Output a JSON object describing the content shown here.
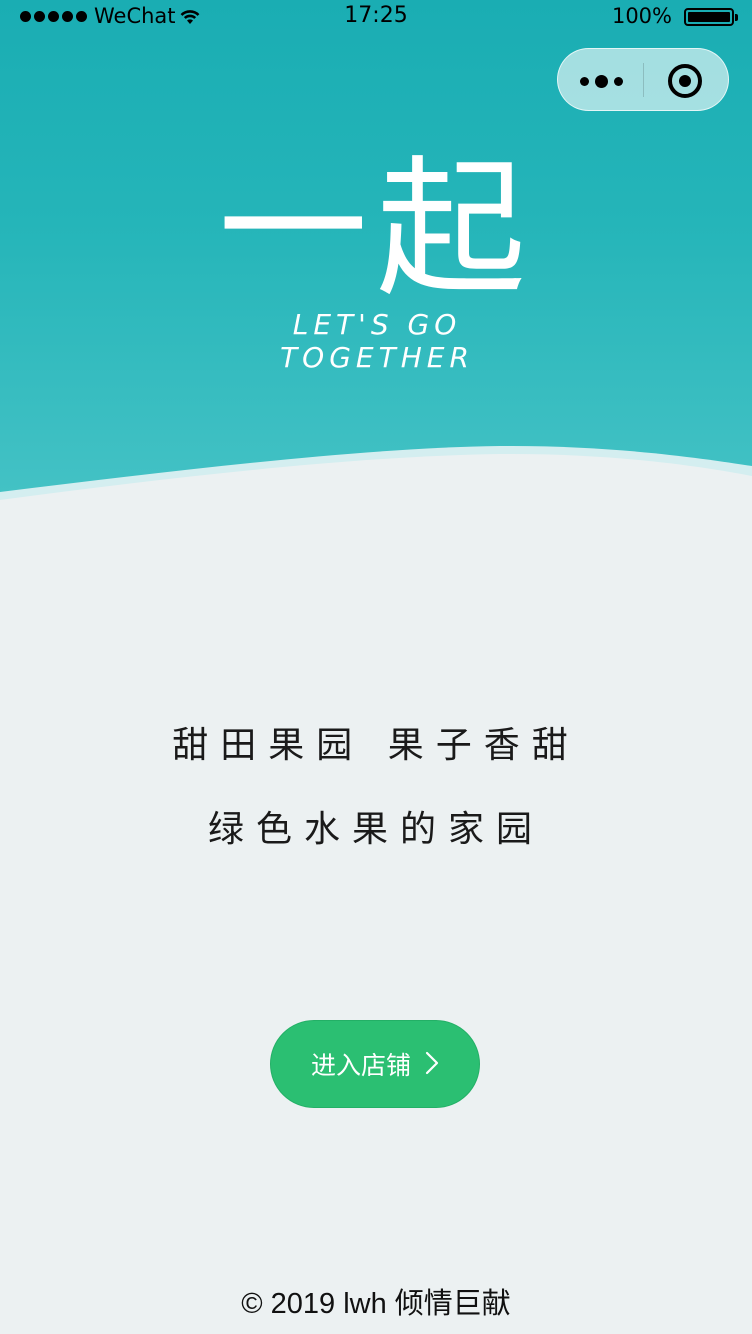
{
  "status_bar": {
    "carrier": "WeChat",
    "time": "17:25",
    "battery": "100%"
  },
  "capsule": {
    "more_icon": "more-dots-icon",
    "close_icon": "target-close-icon"
  },
  "hero": {
    "logo_title": "一起",
    "logo_subtitle": "LET'S GO TOGETHER",
    "gradient_top": "#1aadb3",
    "gradient_bottom": "#44c2c5"
  },
  "slogan": {
    "line1": "甜田果园 果子香甜",
    "line2": "绿色水果的家园"
  },
  "enter_button": {
    "label": "进入店铺",
    "icon": "chevron-right-icon",
    "color": "#2bbf72"
  },
  "footer": {
    "text": "© 2019 lwh 倾情巨献"
  }
}
